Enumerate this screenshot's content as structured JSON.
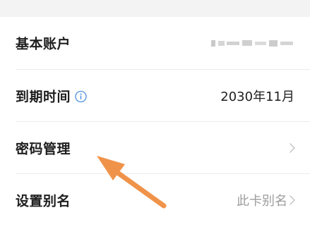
{
  "rows": [
    {
      "label": "基本账户",
      "value": ""
    },
    {
      "label": "到期时间",
      "value": "2030年11月"
    },
    {
      "label": "密码管理",
      "value": ""
    },
    {
      "label": "设置别名",
      "value": "此卡别名"
    }
  ],
  "icons": {
    "info": "info-circle-icon",
    "chevron": "chevron-right-icon",
    "annotation": "orange-arrow"
  },
  "colors": {
    "background": "#ffffff",
    "section_gap": "#f3f3f3",
    "label": "#1e1e1e",
    "muted": "#9d9d9d",
    "info_icon": "#4c8fe0",
    "arrow": "#f0934a"
  }
}
